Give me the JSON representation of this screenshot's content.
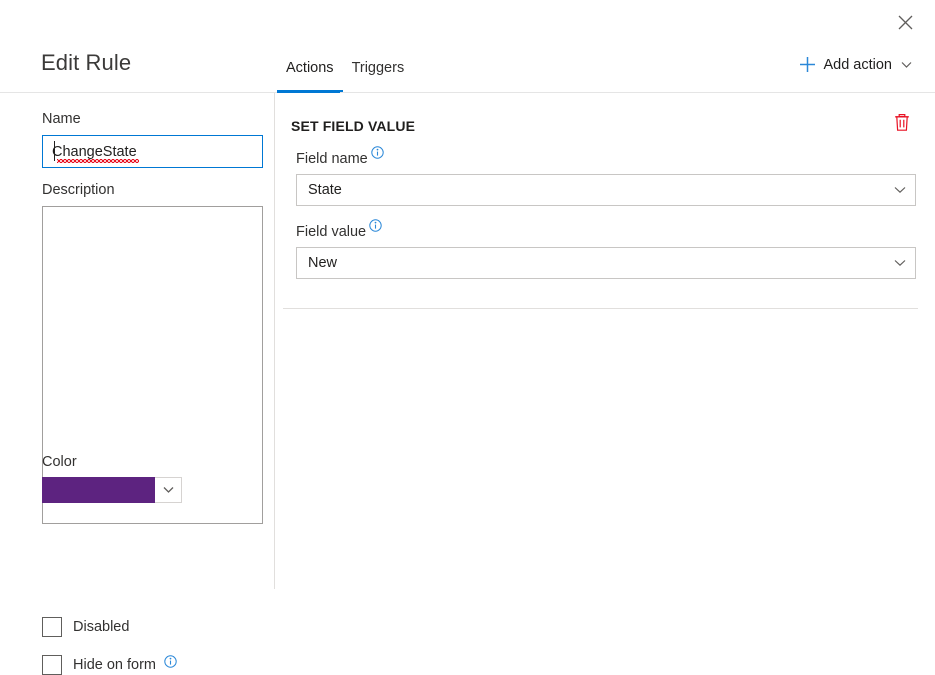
{
  "window": {
    "close_icon": "close-icon"
  },
  "header": {
    "title": "Edit Rule",
    "tabs": [
      {
        "label": "Actions",
        "active": true
      },
      {
        "label": "Triggers",
        "active": false
      }
    ],
    "add_action": {
      "label": "Add action",
      "plus_icon": "plus-icon",
      "caret_icon": "chevron-down-icon"
    }
  },
  "sidebar": {
    "name": {
      "label": "Name",
      "value": "ChangeState",
      "placeholder": "",
      "focused": true,
      "spellcheck_error": true
    },
    "description": {
      "label": "Description",
      "value": "",
      "placeholder": ""
    },
    "color": {
      "label": "Color",
      "value": "#5d2380",
      "caret_icon": "chevron-down-icon"
    },
    "checkboxes": [
      {
        "label": "Disabled",
        "checked": false,
        "has_info": false
      },
      {
        "label": "Hide on form",
        "checked": false,
        "has_info": true
      }
    ]
  },
  "main": {
    "action_card": {
      "title": "SET FIELD VALUE",
      "delete_icon": "trash-icon",
      "delete_color": "#e81123",
      "fields": [
        {
          "label": "Field name",
          "value": "State",
          "info_icon": "info-icon",
          "caret_icon": "chevron-down-icon"
        },
        {
          "label": "Field value",
          "value": "New",
          "info_icon": "info-icon",
          "caret_icon": "chevron-down-icon"
        }
      ]
    }
  },
  "colors": {
    "accent": "#0078d4",
    "plus": "#2b88d8",
    "danger": "#e81123",
    "info": "#2b88d8",
    "border": "#c8c6c4",
    "text": "#323130"
  }
}
